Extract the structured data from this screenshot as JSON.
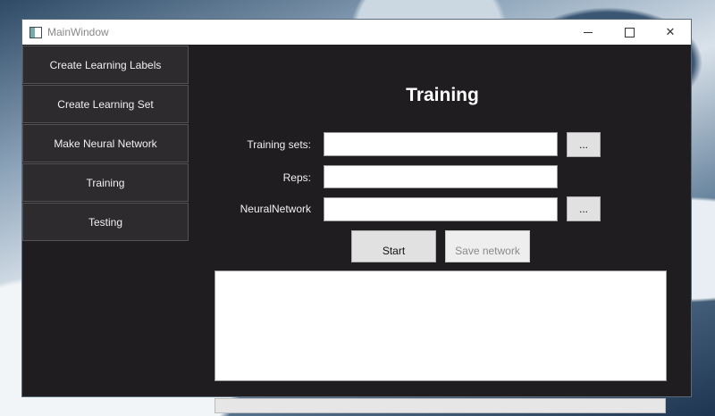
{
  "window": {
    "title": "MainWindow",
    "controls": {
      "minimize": "",
      "maximize": "",
      "close": "✕"
    }
  },
  "sidebar": {
    "items": [
      {
        "label": "Create Learning Labels"
      },
      {
        "label": "Create Learning Set"
      },
      {
        "label": "Make Neural Network"
      },
      {
        "label": "Training"
      },
      {
        "label": "Testing"
      }
    ]
  },
  "main": {
    "title": "Training",
    "fields": {
      "training_sets_label": "Training sets:",
      "training_sets_value": "",
      "reps_label": "Reps:",
      "reps_value": "",
      "neural_network_label": "NeuralNetwork",
      "neural_network_value": "",
      "browse_label": "..."
    },
    "buttons": {
      "start": "Start",
      "save_network": "Save network"
    },
    "log_text": "",
    "progress": 0
  },
  "colors": {
    "window_bg": "#1f1d20",
    "sidebar_button_bg": "#2d2b2e",
    "button_bg": "#e1e1e1"
  }
}
